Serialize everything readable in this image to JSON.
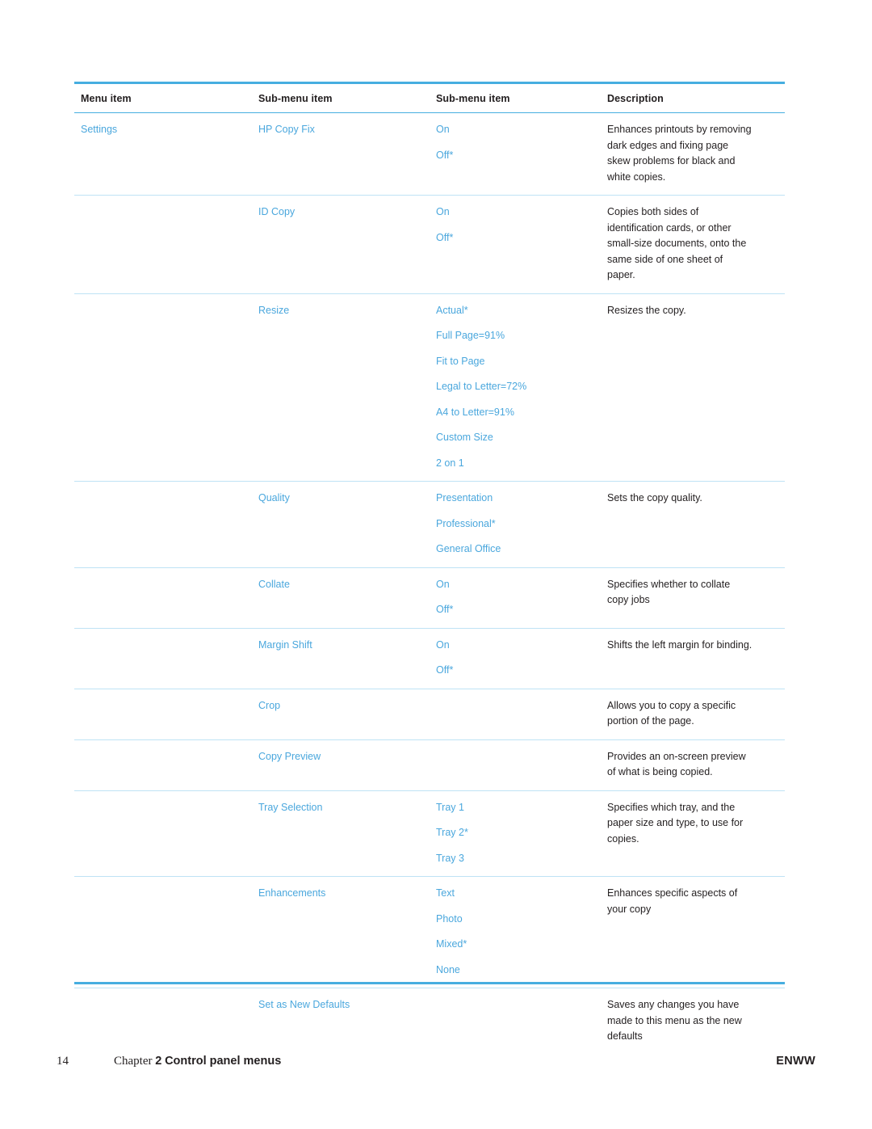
{
  "document": {
    "table": {
      "headers": [
        "Menu item",
        "Sub-menu item",
        "Sub-menu item",
        "Description"
      ],
      "rows": [
        {
          "menu": "Settings",
          "sub1": "HP Copy Fix",
          "sub2": [
            "On",
            "Off*"
          ],
          "desc": [
            "Enhances printouts by removing",
            "dark edges and fixing page",
            "skew problems for black and",
            "white copies."
          ]
        },
        {
          "menu": "",
          "sub1": "ID Copy",
          "sub2": [
            "On",
            "Off*"
          ],
          "desc": [
            "Copies both sides of",
            "identification cards, or other",
            "small-size documents, onto the",
            "same side of one sheet of",
            "paper."
          ]
        },
        {
          "menu": "",
          "sub1": "Resize",
          "sub2": [
            "Actual*",
            "Full Page=91%",
            "Fit to Page",
            "Legal to Letter=72%",
            "A4 to Letter=91%",
            "Custom Size",
            "2 on 1"
          ],
          "desc": [
            "Resizes the copy."
          ]
        },
        {
          "menu": "",
          "sub1": "Quality",
          "sub2": [
            "Presentation",
            "Professional*",
            "General Office"
          ],
          "desc": [
            "Sets the copy quality."
          ]
        },
        {
          "menu": "",
          "sub1": "Collate",
          "sub2": [
            "On",
            "Off*"
          ],
          "desc": [
            "Specifies whether to collate",
            "copy jobs"
          ]
        },
        {
          "menu": "",
          "sub1": "Margin Shift",
          "sub2": [
            "On",
            "Off*"
          ],
          "desc": [
            "Shifts the left margin for binding."
          ]
        },
        {
          "menu": "",
          "sub1": "Crop",
          "sub2": [],
          "desc": [
            "Allows you to copy a specific",
            "portion of the page."
          ]
        },
        {
          "menu": "",
          "sub1": "Copy Preview",
          "sub2": [],
          "desc": [
            "Provides an on-screen preview",
            "of what is being copied."
          ]
        },
        {
          "menu": "",
          "sub1": "Tray Selection",
          "sub2": [
            "Tray 1",
            "Tray 2*",
            "Tray 3"
          ],
          "desc": [
            "Specifies which tray, and the",
            "paper size and type, to use for",
            "copies."
          ]
        },
        {
          "menu": "",
          "sub1": "Enhancements",
          "sub2": [
            "Text",
            "Photo",
            "Mixed*",
            "None"
          ],
          "desc": [
            "Enhances specific aspects of",
            "your copy"
          ]
        },
        {
          "menu": "",
          "sub1": "Set as New Defaults",
          "sub2": [],
          "desc": [
            "Saves any changes you have",
            "made to this menu as the new",
            "defaults"
          ]
        }
      ]
    },
    "footer": {
      "page_number": "14",
      "chapter_word": "Chapter",
      "chapter_number": "2",
      "chapter_title": "Control panel menus",
      "imprint": "ENWW"
    }
  }
}
